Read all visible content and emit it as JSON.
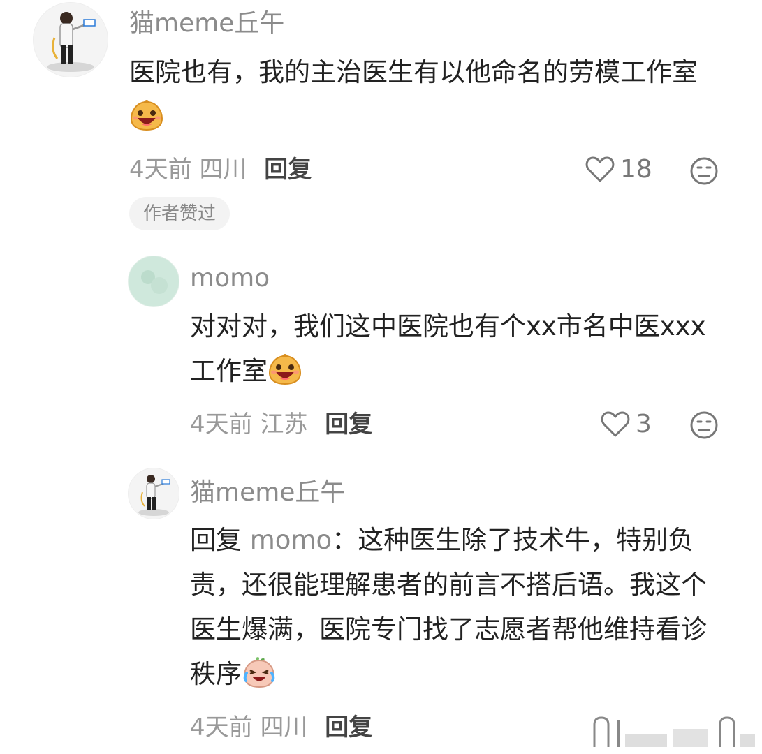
{
  "comments": [
    {
      "username": "猫meme丘午",
      "text": "医院也有，我的主治医生有以他命名的劳模工作室",
      "time": "4天前",
      "location": "四川",
      "reply_label": "回复",
      "likes": "18",
      "badge": "作者赞过",
      "emoji": "laughing-blob-emoji"
    },
    {
      "username": "momo",
      "text": "对对对，我们这中医院也有个xx市名中医xxx工作室",
      "time": "4天前",
      "location": "江苏",
      "reply_label": "回复",
      "likes": "3",
      "emoji": "laughing-blob-emoji"
    },
    {
      "username": "猫meme丘午",
      "reply_prefix": "回复",
      "reply_target": "momo",
      "reply_colon": "：",
      "text": "这种医生除了技术牛，特别负责，还很能理解患者的前言不搭后语。我这个医生爆满，医院专门找了志愿者帮他维持看诊秩序",
      "time": "4天前",
      "location": "四川",
      "reply_label": "回复",
      "emoji": "crying-laughing-emoji"
    }
  ],
  "colors": {
    "username": "#8b8b8b",
    "text": "#222222",
    "meta": "#999999",
    "badge_bg": "#f3f3f3",
    "avatar_momo": "#cfe8dc"
  }
}
